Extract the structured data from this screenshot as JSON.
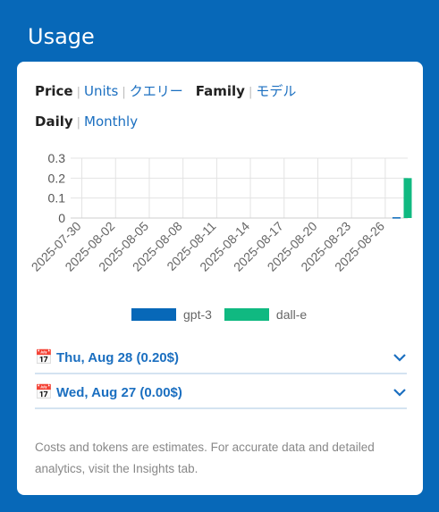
{
  "page": {
    "title": "Usage"
  },
  "toggles": {
    "metric": {
      "active": "Price",
      "options": [
        "Units",
        "クエリー"
      ]
    },
    "group": {
      "active": "Family",
      "options": [
        "モデル"
      ]
    },
    "period": {
      "active": "Daily",
      "options": [
        "Monthly"
      ]
    }
  },
  "chart_data": {
    "type": "bar",
    "title": "",
    "xlabel": "",
    "ylabel": "",
    "ylim": [
      0,
      0.3
    ],
    "yticks": [
      "0.3",
      "0.2",
      "0.1",
      "0"
    ],
    "x_tick_labels": [
      "2025-07-30",
      "2025-08-02",
      "2025-08-05",
      "2025-08-08",
      "2025-08-11",
      "2025-08-14",
      "2025-08-17",
      "2025-08-20",
      "2025-08-23",
      "2025-08-26"
    ],
    "x_range": [
      "2025-07-29",
      "2025-08-28"
    ],
    "grid": true,
    "legend_position": "bottom",
    "series": [
      {
        "name": "gpt-3",
        "color": "#0768b8",
        "points": [
          {
            "x": "2025-08-27",
            "y": 0.004
          }
        ]
      },
      {
        "name": "dall-e",
        "color": "#10b981",
        "points": [
          {
            "x": "2025-08-28",
            "y": 0.2
          }
        ]
      }
    ]
  },
  "days": [
    {
      "icon": "📅",
      "label": "Thu, Aug 28 (0.20$)"
    },
    {
      "icon": "📅",
      "label": "Wed, Aug 27 (0.00$)"
    }
  ],
  "footer_note": "Costs and tokens are estimates. For accurate data and detailed analytics, visit the Insights tab."
}
